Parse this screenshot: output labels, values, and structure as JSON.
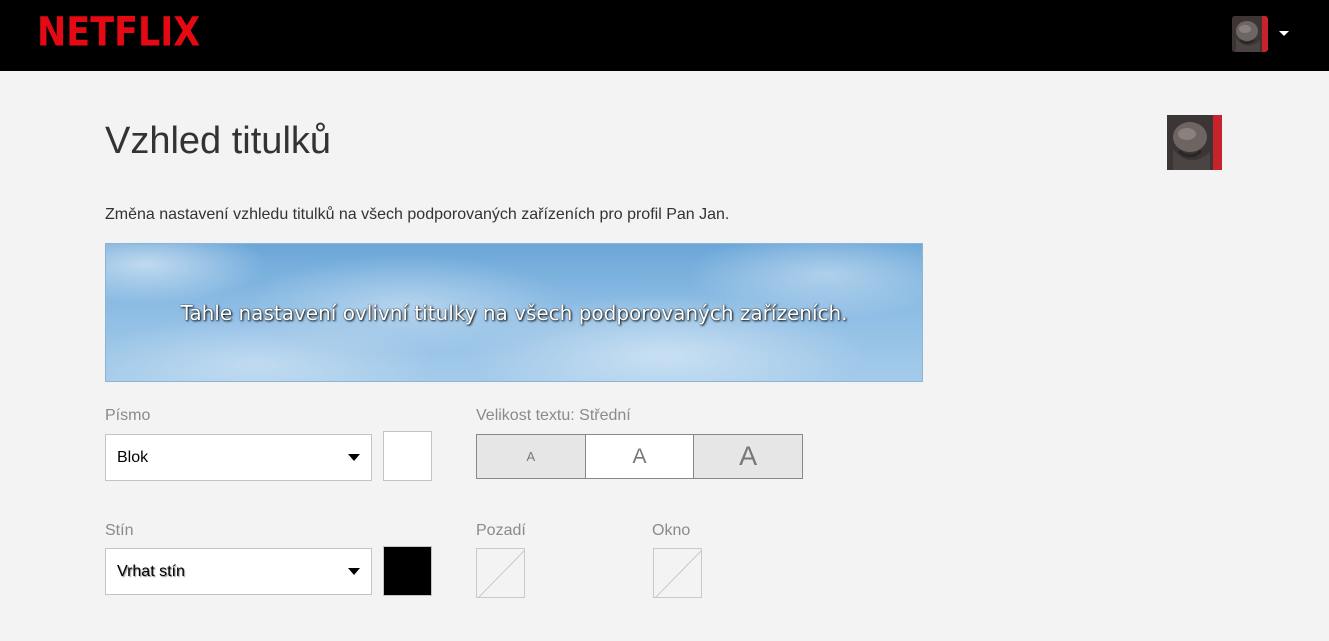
{
  "header": {
    "logo": "NETFLIX",
    "profile_menu_icon": "chevron-down-icon"
  },
  "main": {
    "title": "Vzhled titulků",
    "description": "Změna nastavení vzhledu titulků na všech podporovaných zařízeních pro profil Pan Jan.",
    "preview_text": "Tahle nastavení ovlivní titulky na všech podporovaných zařízeních."
  },
  "font": {
    "label": "Písmo",
    "value": "Blok",
    "color": "#ffffff"
  },
  "text_size": {
    "label": "Velikost textu: Střední",
    "options": [
      "A",
      "A",
      "A"
    ],
    "selected_index": 1
  },
  "shadow": {
    "label": "Stín",
    "value": "Vrhat stín",
    "color": "#000000"
  },
  "background": {
    "label": "Pozadí"
  },
  "window": {
    "label": "Okno"
  }
}
